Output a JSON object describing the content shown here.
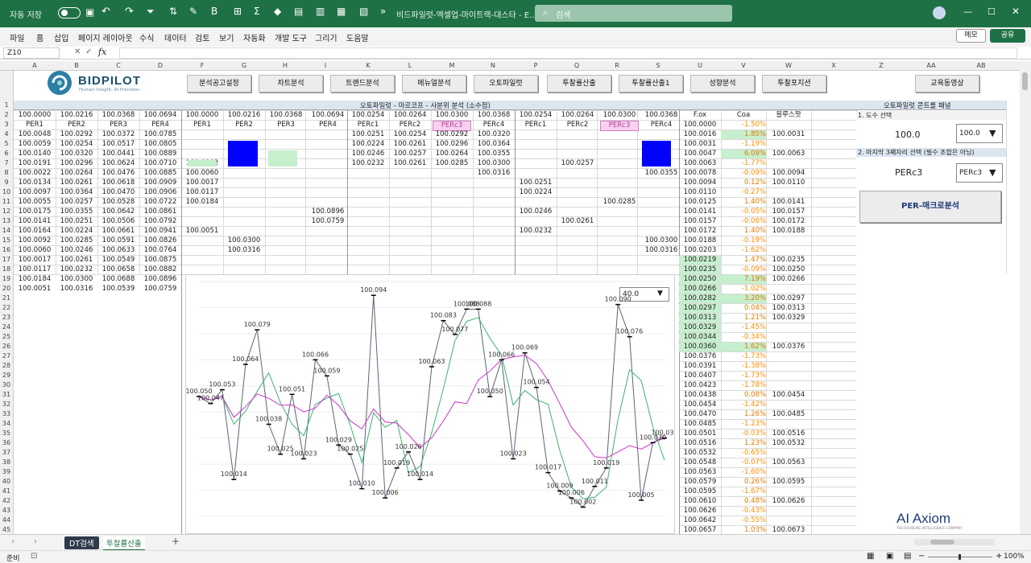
{
  "titlebar": {
    "autosave": "자동 저장",
    "filename": "비드파일럿-엑셀업-마이트랙-대스타 - E...",
    "search_placeholder": "검색"
  },
  "menu": [
    "파일",
    "홈",
    "삽입",
    "페이지 레이아웃",
    "수식",
    "데이터",
    "검토",
    "보기",
    "자동화",
    "개발 도구",
    "그리기",
    "도움말"
  ],
  "menu_right": {
    "memo": "메모",
    "share": "공유"
  },
  "namebox": "Z10",
  "fx": "fx",
  "columns": [
    "A",
    "B",
    "C",
    "D",
    "F",
    "G",
    "H",
    "I",
    "J",
    "K",
    "L",
    "M",
    "N",
    "P",
    "Q",
    "R",
    "S",
    "U",
    "V",
    "W",
    "X",
    "Z",
    "AA",
    "AB"
  ],
  "rows": [
    "1",
    "2",
    "3",
    "4",
    "5",
    "6",
    "7",
    "8",
    "9",
    "10",
    "11",
    "12",
    "13",
    "14",
    "15",
    "16",
    "17",
    "18",
    "19",
    "20",
    "21",
    "22",
    "23",
    "24",
    "25",
    "26",
    "27",
    "28",
    "29",
    "30",
    "31",
    "32",
    "33",
    "34",
    "35",
    "36",
    "37",
    "38",
    "39",
    "40",
    "41",
    "42",
    "43",
    "44",
    "45"
  ],
  "logo": {
    "name": "BIDPILOT",
    "tagline": "Human Insight, AI Precision."
  },
  "buttons": [
    "분석공고설정",
    "차트분석",
    "트랜드분석",
    "메뉴얼분석",
    "오토파일럿",
    "투찰률산출",
    "투찰률산출1",
    "성향분석",
    "투찰포지션",
    "교육동영상"
  ],
  "banner": "오토파일럿 - 마르코프 - 사분위 분석 (소수점)",
  "panel_title": "오토파일럿 콘트롤 패널",
  "block1": {
    "top": [
      "100.0000",
      "100.0216",
      "100.0368",
      "100.0694"
    ],
    "labels": [
      "PER1",
      "PER2",
      "PER3",
      "PER4"
    ],
    "rows": [
      [
        "100.0048",
        "100.0292",
        "100.0372",
        "100.0785"
      ],
      [
        "100.0059",
        "100.0254",
        "100.0517",
        "100.0805"
      ],
      [
        "100.0140",
        "100.0320",
        "100.0441",
        "100.0889"
      ],
      [
        "100.0191",
        "100.0296",
        "100.0624",
        "100.0710"
      ],
      [
        "100.0022",
        "100.0264",
        "100.0476",
        "100.0885"
      ],
      [
        "100.0134",
        "100.0261",
        "100.0618",
        "100.0909"
      ],
      [
        "100.0097",
        "100.0364",
        "100.0470",
        "100.0906"
      ],
      [
        "100.0055",
        "100.0257",
        "100.0528",
        "100.0722"
      ],
      [
        "100.0175",
        "100.0355",
        "100.0642",
        "100.0861"
      ],
      [
        "100.0141",
        "100.0251",
        "100.0506",
        "100.0792"
      ],
      [
        "100.0164",
        "100.0224",
        "100.0661",
        "100.0941"
      ],
      [
        "100.0092",
        "100.0285",
        "100.0591",
        "100.0826"
      ],
      [
        "100.0060",
        "100.0246",
        "100.0633",
        "100.0764"
      ],
      [
        "100.0017",
        "100.0261",
        "100.0549",
        "100.0875"
      ],
      [
        "100.0117",
        "100.0232",
        "100.0658",
        "100.0882"
      ],
      [
        "100.0184",
        "100.0300",
        "100.0688",
        "100.0896"
      ],
      [
        "100.0051",
        "100.0316",
        "100.0539",
        "100.0759"
      ]
    ]
  },
  "block2": {
    "top": [
      "100.0000",
      "100.0216",
      "100.0368",
      "100.0694"
    ],
    "labels": [
      "PER1",
      "PER2",
      "PER3",
      "PER4"
    ],
    "rows": [
      [
        "100.0092",
        "",
        "",
        ""
      ],
      [
        "100.0060",
        "",
        "",
        ""
      ],
      [
        "100.0017",
        "",
        "",
        ""
      ],
      [
        "100.0117",
        "",
        "",
        ""
      ],
      [
        "100.0184",
        "",
        "",
        ""
      ],
      [
        "",
        "",
        "",
        "100.0896"
      ],
      [
        "",
        "",
        "",
        "100.0759"
      ],
      [
        "100.0051",
        "",
        "",
        ""
      ],
      [
        "",
        "100.0300",
        "",
        ""
      ],
      [
        "",
        "100.0316",
        "",
        ""
      ]
    ]
  },
  "block3": {
    "top": [
      "100.0254",
      "100.0264",
      "100.0300",
      "100.0368"
    ],
    "labels": [
      "PERc1",
      "PERc2",
      "PERc3",
      "PERc4"
    ],
    "rows": [
      [
        "100.0251",
        "100.0254",
        "100.0292",
        "100.0320"
      ],
      [
        "100.0224",
        "100.0261",
        "100.0296",
        "100.0364"
      ],
      [
        "100.0246",
        "100.0257",
        "100.0264",
        "100.0355"
      ],
      [
        "100.0232",
        "100.0261",
        "100.0285",
        "100.0300"
      ],
      [
        "",
        "",
        "",
        "100.0316"
      ]
    ]
  },
  "block4": {
    "top": [
      "100.0254",
      "100.0264",
      "100.0300",
      "100.0368"
    ],
    "labels": [
      "PERc1",
      "PERc2",
      "PERc3",
      "PERc4"
    ],
    "rows": [
      [
        "",
        "100.0257",
        "",
        ""
      ],
      [
        "",
        "",
        "",
        "100.0355"
      ],
      [
        "100.0251",
        "",
        "",
        ""
      ],
      [
        "100.0224",
        "",
        "",
        ""
      ],
      [
        "",
        "",
        "100.0285",
        ""
      ],
      [
        "100.0246",
        "",
        "",
        ""
      ],
      [
        "",
        "100.0261",
        "",
        ""
      ],
      [
        "100.0232",
        "",
        "",
        ""
      ],
      [
        "",
        "",
        "",
        "100.0300"
      ],
      [
        "",
        "",
        "",
        "100.0316"
      ]
    ]
  },
  "block5": {
    "headers": [
      "F.ox",
      "Coa",
      "블루스팟"
    ],
    "rows": [
      [
        "100.0000",
        "-1.50%",
        ""
      ],
      [
        "100.0016",
        "1.85%",
        "100.0031"
      ],
      [
        "100.0031",
        "-1.19%",
        ""
      ],
      [
        "100.0047",
        "6.09%",
        "100.0063"
      ],
      [
        "100.0063",
        "-1.77%",
        ""
      ],
      [
        "100.0078",
        "-0.09%",
        "100.0094"
      ],
      [
        "100.0094",
        "0.12%",
        "100.0110"
      ],
      [
        "100.0110",
        "-0.27%",
        ""
      ],
      [
        "100.0125",
        "1.40%",
        "100.0141"
      ],
      [
        "100.0141",
        "-0.05%",
        "100.0157"
      ],
      [
        "100.0157",
        "-0.06%",
        "100.0172"
      ],
      [
        "100.0172",
        "1.40%",
        "100.0188"
      ],
      [
        "100.0188",
        "-0.19%",
        ""
      ],
      [
        "100.0203",
        "-1.62%",
        ""
      ],
      [
        "100.0219",
        "1.47%",
        "100.0235"
      ],
      [
        "100.0235",
        "-0.09%",
        "100.0250"
      ],
      [
        "100.0250",
        "7.19%",
        "100.0266"
      ],
      [
        "100.0266",
        "-1.02%",
        ""
      ],
      [
        "100.0282",
        "3.20%",
        "100.0297"
      ],
      [
        "100.0297",
        "0.04%",
        "100.0313"
      ],
      [
        "100.0313",
        "1.21%",
        "100.0329"
      ],
      [
        "100.0329",
        "-1.45%",
        ""
      ],
      [
        "100.0344",
        "-0.34%",
        ""
      ],
      [
        "100.0360",
        "1.62%",
        "100.0376"
      ],
      [
        "100.0376",
        "-1.73%",
        ""
      ],
      [
        "100.0391",
        "-1.38%",
        ""
      ],
      [
        "100.0407",
        "-1.73%",
        ""
      ],
      [
        "100.0423",
        "-1.78%",
        ""
      ],
      [
        "100.0438",
        "0.08%",
        "100.0454"
      ],
      [
        "100.0454",
        "-1.42%",
        ""
      ],
      [
        "100.0470",
        "1.26%",
        "100.0485"
      ],
      [
        "100.0485",
        "-1.23%",
        ""
      ],
      [
        "100.0501",
        "-0.03%",
        "100.0516"
      ],
      [
        "100.0516",
        "1.23%",
        "100.0532"
      ],
      [
        "100.0532",
        "-0.65%",
        ""
      ],
      [
        "100.0548",
        "-0.07%",
        "100.0563"
      ],
      [
        "100.0563",
        "-1.60%",
        ""
      ],
      [
        "100.0579",
        "0.26%",
        "100.0595"
      ],
      [
        "100.0595",
        "-1.67%",
        ""
      ],
      [
        "100.0610",
        "0.48%",
        "100.0626"
      ],
      [
        "100.0626",
        "-0.43%",
        ""
      ],
      [
        "100.0642",
        "-0.55%",
        ""
      ],
      [
        "100.0657",
        "1.03%",
        "100.0673"
      ]
    ]
  },
  "control": {
    "step1": "1. 도수 선택",
    "step1_value": "100.0",
    "step1_select": "100.0",
    "step2": "2. 마지막 3째자리 선택 (필수 조합은 아님)",
    "step2_value": "PERc3",
    "step2_select": "PERc3",
    "macro_button": "PER-매크로분석"
  },
  "chart_dropdown": "40.0",
  "watermark": {
    "brand": "AI Axiom",
    "sub": "THE DOUBLING INTELLIGENCE COMPANY"
  },
  "chart_data": {
    "type": "line",
    "series": [
      {
        "values": [
          100.05,
          100.047,
          100.053,
          100.014,
          100.064,
          100.079,
          100.038,
          100.025,
          100.051,
          100.023,
          100.066,
          100.059,
          100.029,
          100.025,
          100.01,
          100.094,
          100.006,
          100.019,
          100.026,
          100.014,
          100.063,
          100.083,
          100.077,
          100.088,
          100.088,
          100.05,
          100.066,
          100.023,
          100.069,
          100.054,
          100.017,
          100.009,
          100.006,
          100.002,
          100.011,
          100.019,
          100.09,
          100.076,
          100.005,
          100.03,
          100.032
        ],
        "labels": [
          "100.050",
          "100.047",
          "100.053",
          "100.014",
          "100.064",
          "100.079",
          "100.038",
          "100.025",
          "100.051",
          "100.023",
          "100.066",
          "100.059",
          "100.029",
          "100.025",
          "100.010",
          "100.094",
          "100.006",
          "100.019",
          "100.026",
          "100.014",
          "100.063",
          "100.083",
          "100.077",
          "100.088",
          "100.088",
          "100.050",
          "100.066",
          "100.023",
          "100.069",
          "100.054",
          "100.017",
          "100.009",
          "100.006",
          "100.002",
          "100.011",
          "100.019",
          "100.090",
          "100.076",
          "100.005",
          "100.030",
          "100.032"
        ],
        "color": "#5a6478"
      },
      {
        "color": "#3cb371"
      },
      {
        "color": "#cc33cc"
      }
    ]
  },
  "sheet_tabs": [
    "DT검색",
    "투찰률산출"
  ],
  "status": {
    "ready": "준비",
    "zoom": "100%"
  },
  "colors": {
    "excel_green": "#1e7145",
    "blue_block": "#0000ff",
    "green_block": "#c6efce",
    "pink": "#f8d0f0",
    "header_bg": "#dce6f1",
    "coa_green": "#c6efce",
    "coa_neg": "#ff8c00",
    "coa_pos": "#2e8b57"
  }
}
